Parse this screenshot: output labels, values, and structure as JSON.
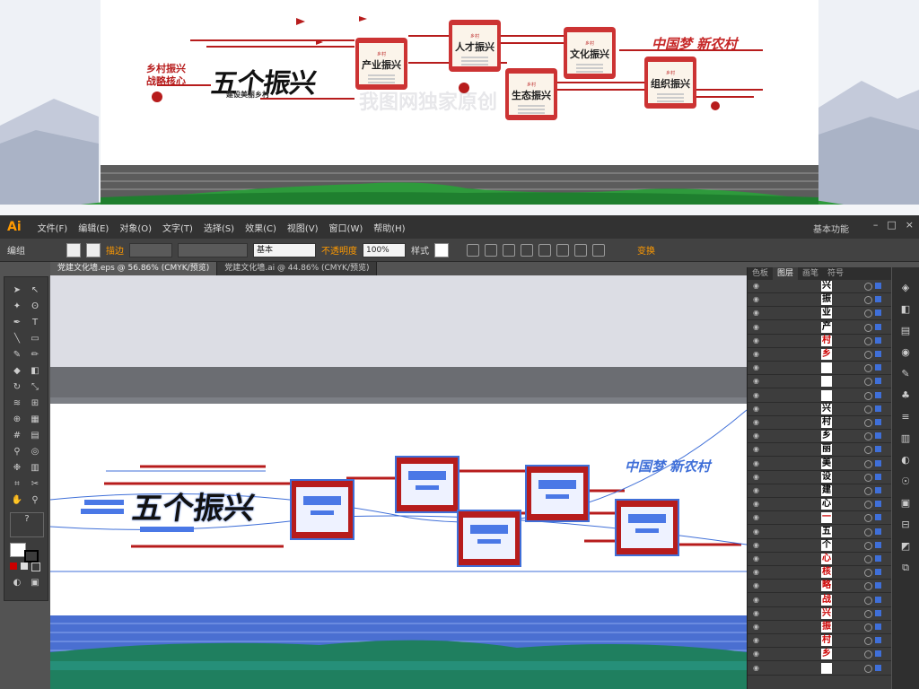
{
  "preview": {
    "slogan_line1": "乡村振兴",
    "slogan_line2": "战略核心",
    "main_title": "五个振兴",
    "sub_title": "建设美丽乡村",
    "slogan_right": "中国梦 新农村",
    "watermark": "我图网独家原创",
    "boards": [
      {
        "kicker": "乡村",
        "title": "产业振兴"
      },
      {
        "kicker": "乡村",
        "title": "人才振兴"
      },
      {
        "kicker": "乡村",
        "title": "生态振兴"
      },
      {
        "kicker": "乡村",
        "title": "文化振兴"
      },
      {
        "kicker": "乡村",
        "title": "组织振兴"
      }
    ]
  },
  "app": {
    "logo": "Ai",
    "menu": [
      "文件(F)",
      "编辑(E)",
      "对象(O)",
      "文字(T)",
      "选择(S)",
      "效果(C)",
      "视图(V)",
      "窗口(W)",
      "帮助(H)"
    ],
    "workspace": "基本功能",
    "window_buttons": [
      "–",
      "□",
      "×"
    ],
    "control": {
      "group_label": "编组",
      "stroke_label": "描边",
      "stroke_style": "基本",
      "opacity_label": "不透明度",
      "opacity_value": "100%",
      "style_label": "样式",
      "transform_label": "变换"
    },
    "tabs": [
      {
        "label": "党建文化墙.eps @ 56.86% (CMYK/预览)",
        "active": true
      },
      {
        "label": "党建文化墙.ai @ 44.86% (CMYK/预览)",
        "active": false
      }
    ],
    "panel_tabs": [
      "色板",
      "图层",
      "画笔",
      "符号"
    ],
    "layers": [
      {
        "glyph": "兴",
        "red": false
      },
      {
        "glyph": "振",
        "red": false
      },
      {
        "glyph": "业",
        "red": false
      },
      {
        "glyph": "产",
        "red": false
      },
      {
        "glyph": "村",
        "red": true
      },
      {
        "glyph": "乡",
        "red": true
      },
      {
        "glyph": "",
        "red": false
      },
      {
        "glyph": "",
        "red": false
      },
      {
        "glyph": "",
        "red": true
      },
      {
        "glyph": "兴",
        "red": false
      },
      {
        "glyph": "村",
        "red": false
      },
      {
        "glyph": "乡",
        "red": false
      },
      {
        "glyph": "丽",
        "red": false
      },
      {
        "glyph": "美",
        "red": false
      },
      {
        "glyph": "设",
        "red": false
      },
      {
        "glyph": "建",
        "red": false
      },
      {
        "glyph": "心",
        "red": false
      },
      {
        "glyph": "一",
        "red": true
      },
      {
        "glyph": "五",
        "red": false
      },
      {
        "glyph": "个",
        "red": false
      },
      {
        "glyph": "心",
        "red": true
      },
      {
        "glyph": "核",
        "red": true
      },
      {
        "glyph": "略",
        "red": true
      },
      {
        "glyph": "战",
        "red": true
      },
      {
        "glyph": "兴",
        "red": true
      },
      {
        "glyph": "振",
        "red": true
      },
      {
        "glyph": "村",
        "red": true
      },
      {
        "glyph": "乡",
        "red": true
      },
      {
        "glyph": "",
        "red": true
      }
    ],
    "canvas_text": {
      "main_title": "五个振兴",
      "slogan_right": "中国梦 新农村"
    }
  }
}
